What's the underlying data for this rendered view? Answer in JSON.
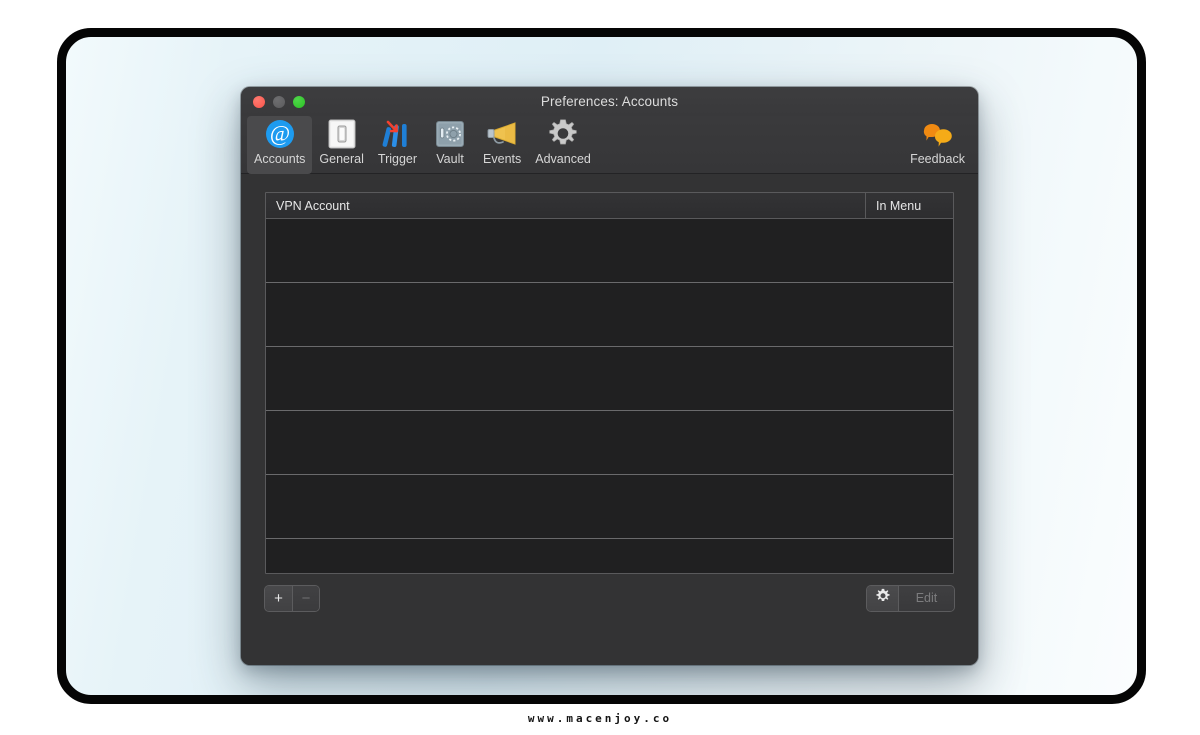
{
  "window": {
    "title": "Preferences: Accounts",
    "traffic_lights": [
      {
        "name": "close",
        "color": "#f9544a",
        "label": "Close"
      },
      {
        "name": "minimize",
        "color": "#5b5b5d",
        "label": "Minimize"
      },
      {
        "name": "zoom",
        "color": "#2cc125",
        "label": "Zoom"
      }
    ]
  },
  "toolbar": {
    "items": [
      {
        "label": "Accounts",
        "icon": "at-sign-icon",
        "selected": true
      },
      {
        "label": "General",
        "icon": "light-switch-icon",
        "selected": false
      },
      {
        "label": "Trigger",
        "icon": "trigger-arrow-icon",
        "selected": false
      },
      {
        "label": "Vault",
        "icon": "safe-vault-icon",
        "selected": false
      },
      {
        "label": "Events",
        "icon": "megaphone-icon",
        "selected": false
      },
      {
        "label": "Advanced",
        "icon": "gear-icon",
        "selected": false
      }
    ],
    "right_item": {
      "label": "Feedback",
      "icon": "speech-bubbles-icon",
      "selected": false
    }
  },
  "table": {
    "columns": [
      {
        "key": "vpn_account",
        "label": "VPN Account"
      },
      {
        "key": "in_menu",
        "label": "In Menu"
      }
    ],
    "rows": [],
    "empty_row_count": 6
  },
  "bottom_bar": {
    "add_label": "+",
    "remove_label": "−",
    "add_enabled": true,
    "remove_enabled": false,
    "gear_icon": "gear-icon",
    "edit_label": "Edit",
    "edit_enabled": false
  },
  "footer": {
    "watermark": "www.macenjoy.co"
  },
  "colors": {
    "accent_blue": "#1d9bf0",
    "window_bg": "#333334",
    "table_bg": "#1f1f20",
    "frame_border": "#050505",
    "page_bg_light": "#e2f1f7"
  }
}
